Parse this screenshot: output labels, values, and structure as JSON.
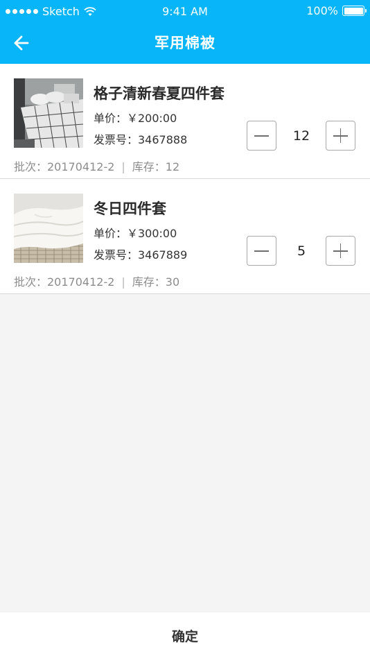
{
  "status_bar": {
    "carrier": "Sketch",
    "time": "9:41 AM",
    "battery": "100%"
  },
  "navbar": {
    "title": "军用棉被",
    "back_icon": "arrow-left-icon"
  },
  "items": [
    {
      "name": "格子清新春夏四件套",
      "price": "单价：￥200:00",
      "invoice": "发票号：3467888",
      "batch": "批次：20170412-2",
      "separator": "|",
      "stock": "库存：12",
      "quantity": "12"
    },
    {
      "name": "冬日四件套",
      "price": "单价：￥300:00",
      "invoice": "发票号：3467889",
      "batch": "批次：20170412-2",
      "separator": "|",
      "stock": "库存：30",
      "quantity": "5"
    }
  ],
  "footer": {
    "confirm_label": "确定"
  },
  "colors": {
    "accent": "#08b5f8",
    "background": "#f4f4f4"
  }
}
